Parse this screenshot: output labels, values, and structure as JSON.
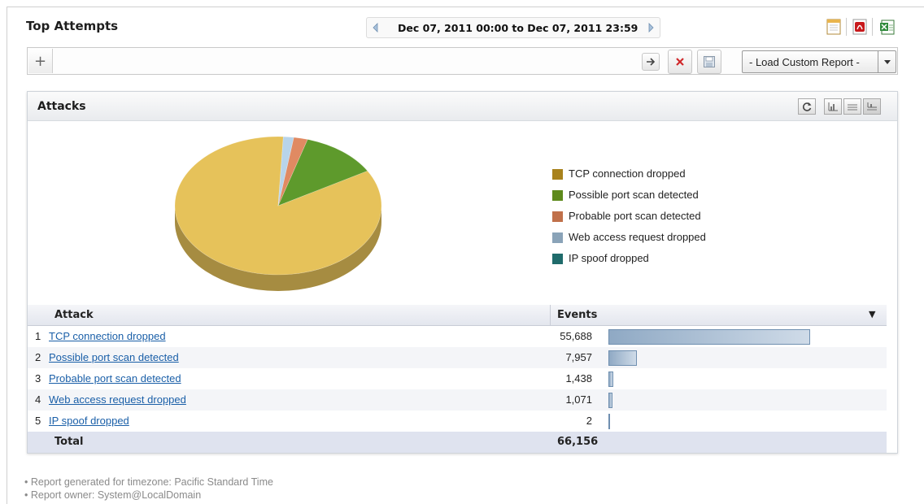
{
  "report": {
    "title": "Top Attempts",
    "date_range": "Dec 07, 2011 00:00 to Dec 07, 2011 23:59",
    "load_custom_report": "- Load Custom Report -"
  },
  "panel": {
    "title": "Attacks"
  },
  "legend": [
    {
      "label": "TCP connection dropped",
      "color": "#a8821c"
    },
    {
      "label": "Possible port scan detected",
      "color": "#5e8a1c"
    },
    {
      "label": "Probable port scan detected",
      "color": "#c0704a"
    },
    {
      "label": "Web access request dropped",
      "color": "#8aa3b8"
    },
    {
      "label": "IP spoof dropped",
      "color": "#1f6b6b"
    }
  ],
  "table": {
    "col_attack": "Attack",
    "col_events": "Events",
    "sort_indicator": "▼",
    "rows": [
      {
        "rank": "1",
        "attack": "TCP connection dropped",
        "events": "55,688"
      },
      {
        "rank": "2",
        "attack": "Possible port scan detected",
        "events": "7,957"
      },
      {
        "rank": "3",
        "attack": "Probable port scan detected",
        "events": "1,438"
      },
      {
        "rank": "4",
        "attack": "Web access request dropped",
        "events": "1,071"
      },
      {
        "rank": "5",
        "attack": "IP spoof dropped",
        "events": "2"
      }
    ],
    "total_label": "Total",
    "total_value": "66,156"
  },
  "chart_data": {
    "type": "pie",
    "categories": [
      "TCP connection dropped",
      "Possible port scan detected",
      "Probable port scan detected",
      "Web access request dropped",
      "IP spoof dropped"
    ],
    "values": [
      55688,
      7957,
      1438,
      1071,
      2
    ],
    "colors": [
      "#e6c25a",
      "#5e9a2c",
      "#e08a62",
      "#b8d4ea",
      "#1f6b6b"
    ],
    "legend_position": "right"
  },
  "footer": {
    "timezone_note": "Report generated for timezone: Pacific Standard Time",
    "owner_note": "Report owner: System@LocalDomain"
  },
  "icons": {
    "date_prev": "triangle-left-icon",
    "date_next": "triangle-right-icon",
    "export_html": "document-icon",
    "export_pdf": "pdf-icon",
    "export_excel": "excel-icon",
    "add_filter": "plus-icon",
    "apply_filter": "arrow-right-icon",
    "clear_filter": "close-icon",
    "save_filter": "save-icon",
    "refresh": "refresh-icon",
    "view_chart": "bar-chart-icon",
    "view_table": "list-icon",
    "view_both": "chart-table-icon"
  }
}
